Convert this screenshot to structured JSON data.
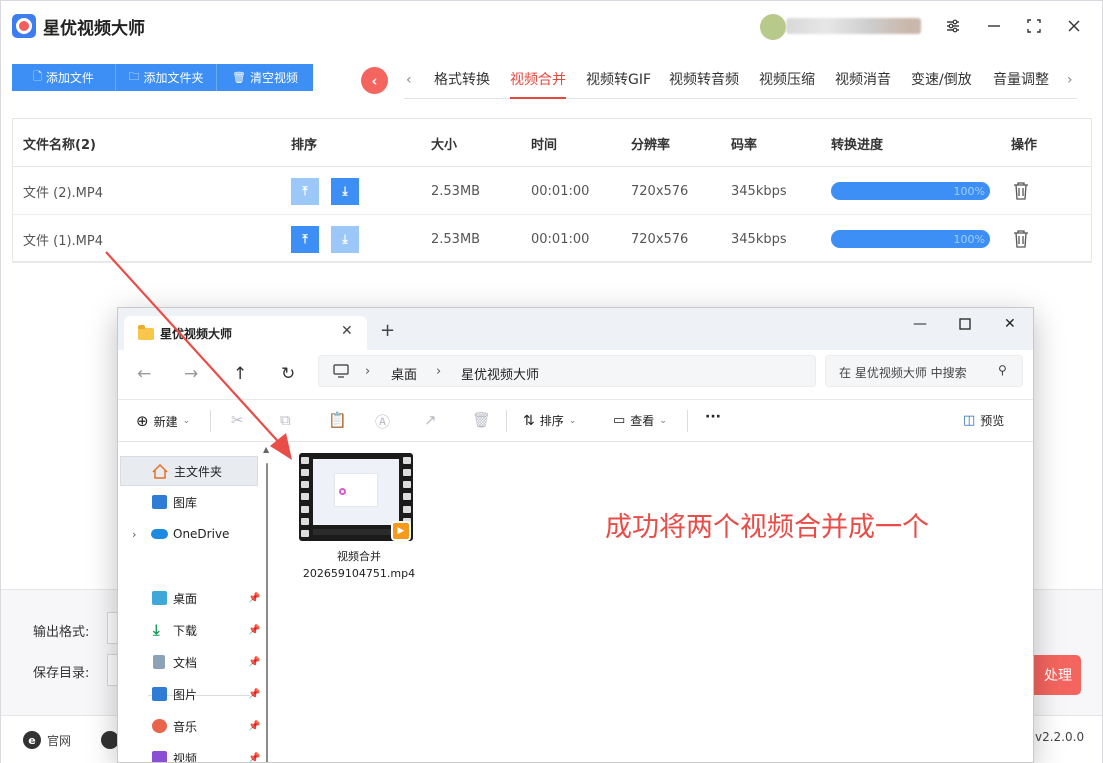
{
  "app": {
    "title": "星优视频大师",
    "toolbar": {
      "add_file": "添加文件",
      "add_folder": "添加文件夹",
      "clear_video": "清空视频"
    },
    "tabs": [
      "格式转换",
      "视频合并",
      "视频转GIF",
      "视频转音频",
      "视频压缩",
      "视频消音",
      "变速/倒放",
      "音量调整"
    ],
    "active_tab": "视频合并",
    "table": {
      "headers": [
        "文件名称(2)",
        "排序",
        "大小",
        "时间",
        "分辨率",
        "码率",
        "转换进度",
        "操作"
      ],
      "rows": [
        {
          "name": "文件 (2).MP4",
          "size": "2.53MB",
          "time": "00:01:00",
          "resolution": "720x576",
          "bitrate": "345kbps",
          "progress": "100%"
        },
        {
          "name": "文件 (1).MP4",
          "size": "2.53MB",
          "time": "00:01:00",
          "resolution": "720x576",
          "bitrate": "345kbps",
          "progress": "100%"
        }
      ]
    },
    "bottom": {
      "output_format_label": "输出格式:",
      "save_dir_label": "保存目录:",
      "process_label": "处理"
    },
    "footer": {
      "website": "官网",
      "version": "v2.2.0.0"
    }
  },
  "explorer": {
    "tab_title": "星优视频大师",
    "breadcrumb": [
      "桌面",
      "星优视频大师"
    ],
    "search_placeholder": "在 星优视频大师 中搜索",
    "toolbar": {
      "new": "新建",
      "sort": "排序",
      "view": "查看",
      "more": "···",
      "preview": "预览"
    },
    "sidebar": [
      {
        "label": "主文件夹",
        "icon": "home-icon"
      },
      {
        "label": "图库",
        "icon": "gallery-icon"
      },
      {
        "label": "OneDrive",
        "icon": "onedrive-icon"
      },
      {
        "label": "桌面",
        "icon": "desktop-icon"
      },
      {
        "label": "下载",
        "icon": "download-icon"
      },
      {
        "label": "文档",
        "icon": "document-icon"
      },
      {
        "label": "图片",
        "icon": "pictures-icon"
      },
      {
        "label": "音乐",
        "icon": "music-icon"
      },
      {
        "label": "视频",
        "icon": "video-icon"
      }
    ],
    "file": {
      "name_line1": "视频合并",
      "name_line2": "202659104751.mp4"
    }
  },
  "annotation": {
    "text": "成功将两个视频合并成一个",
    "color": "#e84d48"
  },
  "colors": {
    "accent_blue": "#3d8ef5",
    "accent_red": "#f4655f",
    "active_tab": "#e4493f"
  }
}
